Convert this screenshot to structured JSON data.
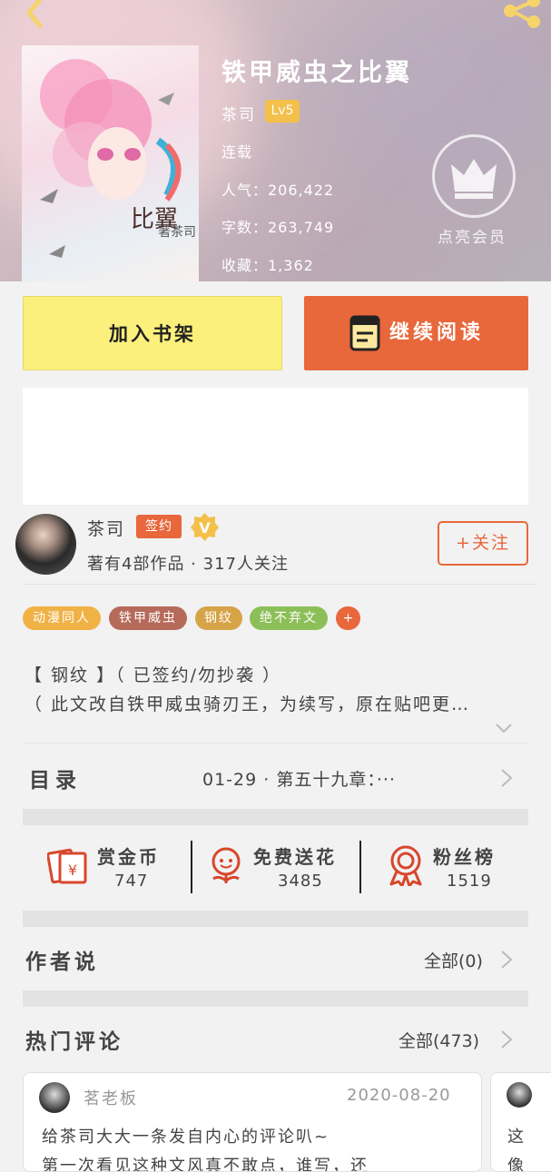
{
  "book": {
    "title": "铁甲威虫之比翼",
    "author": "茶司",
    "level": "Lv5",
    "status": "连载",
    "popularity": "人气：206,422",
    "word_count": "字数：263,749",
    "favorites": "收藏：1,362",
    "cover_text": "比翼",
    "cover_author": "著茶司"
  },
  "vip": {
    "label": "点亮会员",
    "icon": "crown-icon"
  },
  "actions": {
    "add_shelf": "加入书架",
    "continue_read": "继续阅读"
  },
  "author": {
    "name": "茶司",
    "signed_badge": "签约",
    "verified_badge": "V",
    "stats": "著有4部作品 · 317人关注",
    "follow": "+关注"
  },
  "tags": [
    {
      "label": "动漫同人",
      "color": "#f0b245"
    },
    {
      "label": "铁甲威虫",
      "color": "#b66a5a"
    },
    {
      "label": "钢纹",
      "color": "#d6a347"
    },
    {
      "label": "绝不弃文",
      "color": "#8cbf58"
    },
    {
      "label": "+",
      "color": "#e8673b"
    }
  ],
  "description": {
    "line1": "【 钢纹 】（ 已签约/勿抄袭 ）",
    "line2": "（ 此文改自铁甲威虫骑刃王，为续写，原在贴吧更…"
  },
  "catalog": {
    "title": "目录",
    "latest": "01-29 · 第五十九章：···"
  },
  "stats": [
    {
      "label": "赏金币",
      "value": "747",
      "icon": "coin-envelope-icon"
    },
    {
      "label": "免费送花",
      "value": "3485",
      "icon": "flower-icon"
    },
    {
      "label": "粉丝榜",
      "value": "1519",
      "icon": "ribbon-medal-icon"
    }
  ],
  "author_says": {
    "title": "作者说",
    "all": "全部(0)"
  },
  "hot_comments": {
    "title": "热门评论",
    "all": "全部(473)",
    "items": [
      {
        "user": "茗老板",
        "date": "2020-08-20",
        "text": "给茶司大大一条发自内心的评论叭~",
        "text2": "第一次看见这种文风真不敢点，谁写，还"
      },
      {
        "user": "",
        "date": "",
        "text": "这",
        "text2": "像"
      }
    ]
  },
  "colors": {
    "accent": "#e8673b",
    "shelf_button": "#fbf07c",
    "level_badge": "#f3c04b"
  }
}
